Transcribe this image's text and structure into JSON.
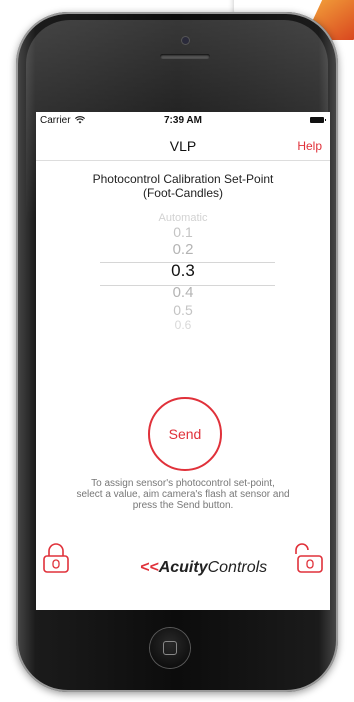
{
  "status_bar": {
    "carrier": "Carrier",
    "wifi_icon": "wifi-icon",
    "time": "7:39 AM",
    "battery_icon": "battery-icon"
  },
  "nav": {
    "title": "VLP",
    "help_label": "Help"
  },
  "heading": {
    "line1": "Photocontrol Calibration Set-Point",
    "line2": "(Foot-Candles)"
  },
  "picker": {
    "options": [
      "Automatic",
      "0.1",
      "0.2",
      "0.3",
      "0.4",
      "0.5",
      "0.6"
    ],
    "selected": "0.3"
  },
  "send_label": "Send",
  "instructions": [
    "To assign sensor's photocontrol set-point,",
    "select a value, aim camera's flash at sensor and",
    "press the Send button."
  ],
  "logo": {
    "word1": "Acuity",
    "word2": "Controls"
  },
  "icons": {
    "left": "lock-closed-icon",
    "right": "lock-open-icon"
  },
  "colors": {
    "accent": "#e0313a",
    "picker_inactive": "#c8c8c8"
  }
}
